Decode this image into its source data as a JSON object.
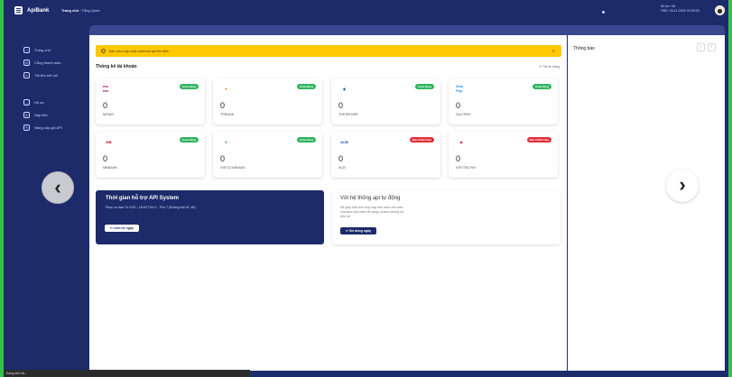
{
  "header": {
    "brand": "ApiBank",
    "breadcrumb_current": "Trang chủ",
    "breadcrumb_sep": "›",
    "breadcrumb_sub": "Tổng Quan",
    "user_line1": "Số dư: 0đ",
    "user_line2": "HSD: 29-11-2022 09:35:03"
  },
  "sidebar": {
    "items": [
      {
        "label": "Trang chủ",
        "icon": "home-icon"
      },
      {
        "label": "Cổng thanh toán",
        "icon": "gateway-icon"
      },
      {
        "label": "Tài liệu kết nối",
        "icon": "link-icon"
      },
      {
        "label": "Hồ sơ",
        "icon": "user-icon"
      },
      {
        "label": "Nạp tiền",
        "icon": "dollar-icon"
      },
      {
        "label": "Nâng cấp gói API",
        "icon": "upgrade-icon"
      }
    ]
  },
  "alert": {
    "text": "Bạn chưa cập nhật webhook giá tiền định"
  },
  "stats": {
    "title": "Thống kê tài khoản",
    "refresh": "Tải lại trang",
    "cards": [
      {
        "name": "MOMO",
        "count": "0",
        "badge": "Hoạt động",
        "badge_color": "#2fb45f",
        "logo": "mo mo",
        "logo_color": "#b0006d"
      },
      {
        "name": "TPBANK",
        "count": "0",
        "badge": "Hoạt động",
        "badge_color": "#2fb45f",
        "logo": "▼",
        "logo_color": "#f26f21"
      },
      {
        "name": "THESIEURE",
        "count": "0",
        "badge": "Hoạt động",
        "badge_color": "#2fb45f",
        "logo": "◆",
        "logo_color": "#2a5ea9"
      },
      {
        "name": "ZALOPAY",
        "count": "0",
        "badge": "Hoạt động",
        "badge_color": "#2fb45f",
        "logo": "Zalo Pay",
        "logo_color": "#1a8cff"
      },
      {
        "name": "MBBANK",
        "count": "0",
        "badge": "Hoạt động",
        "badge_color": "#2fb45f",
        "logo": "MB",
        "logo_color": "#d0021b"
      },
      {
        "name": "VIETCOMBANK",
        "count": "0",
        "badge": "Hoạt động",
        "badge_color": "#2fb45f",
        "logo": "V",
        "logo_color": "#0a7b3a"
      },
      {
        "name": "ACB",
        "count": "0",
        "badge": "Bảo trì/Hết hạn",
        "badge_color": "#e0303a",
        "logo": "ACB",
        "logo_color": "#1f4aa8"
      },
      {
        "name": "VIETTELPAY",
        "count": "0",
        "badge": "Bảo trì/Hết hạn",
        "badge_color": "#e0303a",
        "logo": "▶",
        "logo_color": "#e0233a"
      }
    ]
  },
  "support": {
    "title": "Thời gian hỗ trợ API System",
    "desc": "Phục vụ bạn Từ 9:00 - 18:00 Thứ 2 - Thứ 7 (Không tính lễ, tết)",
    "button": "Liên hệ ngay"
  },
  "api": {
    "title": "Với hệ thống api tự động",
    "desc": "Sẽ giúp bạn tích hợp nạp tiền auto cho web của bạn một cách dễ dàng, nhanh chóng và tiện lợi",
    "button": "Sử dụng ngay"
  },
  "notifications": {
    "title": "Thông báo",
    "prev": "‹",
    "next": "›"
  },
  "nav": {
    "left": "‹",
    "right": "›"
  },
  "status_bar": "Đang kết nối..."
}
